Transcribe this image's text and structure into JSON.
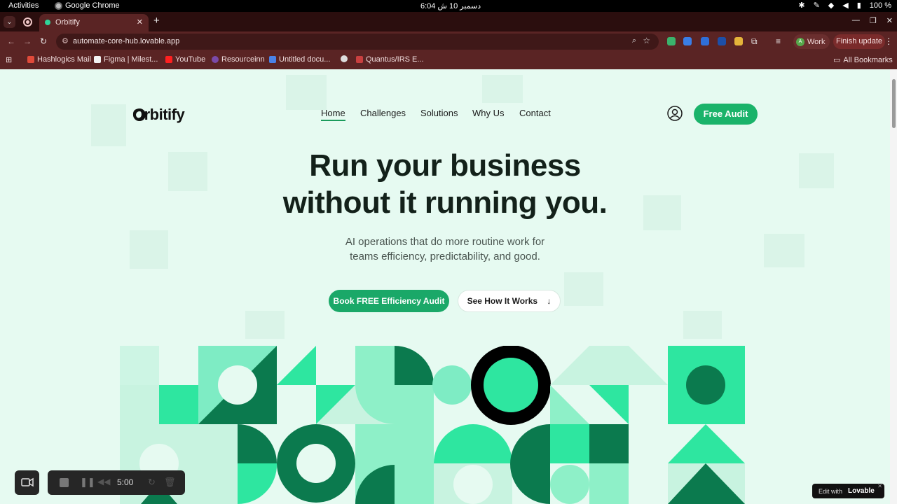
{
  "system_bar": {
    "activities": "Activities",
    "app_name": "Google Chrome",
    "clock": "6:04 دسمبر 10 ش",
    "battery": "100 %"
  },
  "browser": {
    "tab_title": "Orbitify",
    "url": "automate-core-hub.lovable.app",
    "profile_initial": "A",
    "profile_label": "Work",
    "finish_update": "Finish update",
    "bookmarks": [
      "Hashlogics Mail",
      "Figma | Milest...",
      "YouTube",
      "Resourceinn",
      "Untitled docu...",
      "Quantus/IRS E..."
    ],
    "all_bookmarks": "All Bookmarks"
  },
  "site": {
    "brand": "Orbitify",
    "nav": [
      "Home",
      "Challenges",
      "Solutions",
      "Why Us",
      "Contact"
    ],
    "cta_top": "Free Audit",
    "headline_line1": "Run your business",
    "headline_line2": "without it running you.",
    "subtext_line1": "AI operations that do more routine work for",
    "subtext_line2": "teams efficiency, predictability, and good.",
    "primary_button": "Book FREE Efficiency Audit",
    "secondary_button": "See How It Works",
    "colors": {
      "primary": "#1aa868",
      "mint": "#2ee6a0",
      "dark_green": "#0b7a4e",
      "light_mint": "#8ef0c8",
      "background": "#e6faf1"
    }
  },
  "recorder": {
    "time": "5:00"
  },
  "badge": {
    "edit_with": "Edit with",
    "brand": "Lovable"
  }
}
